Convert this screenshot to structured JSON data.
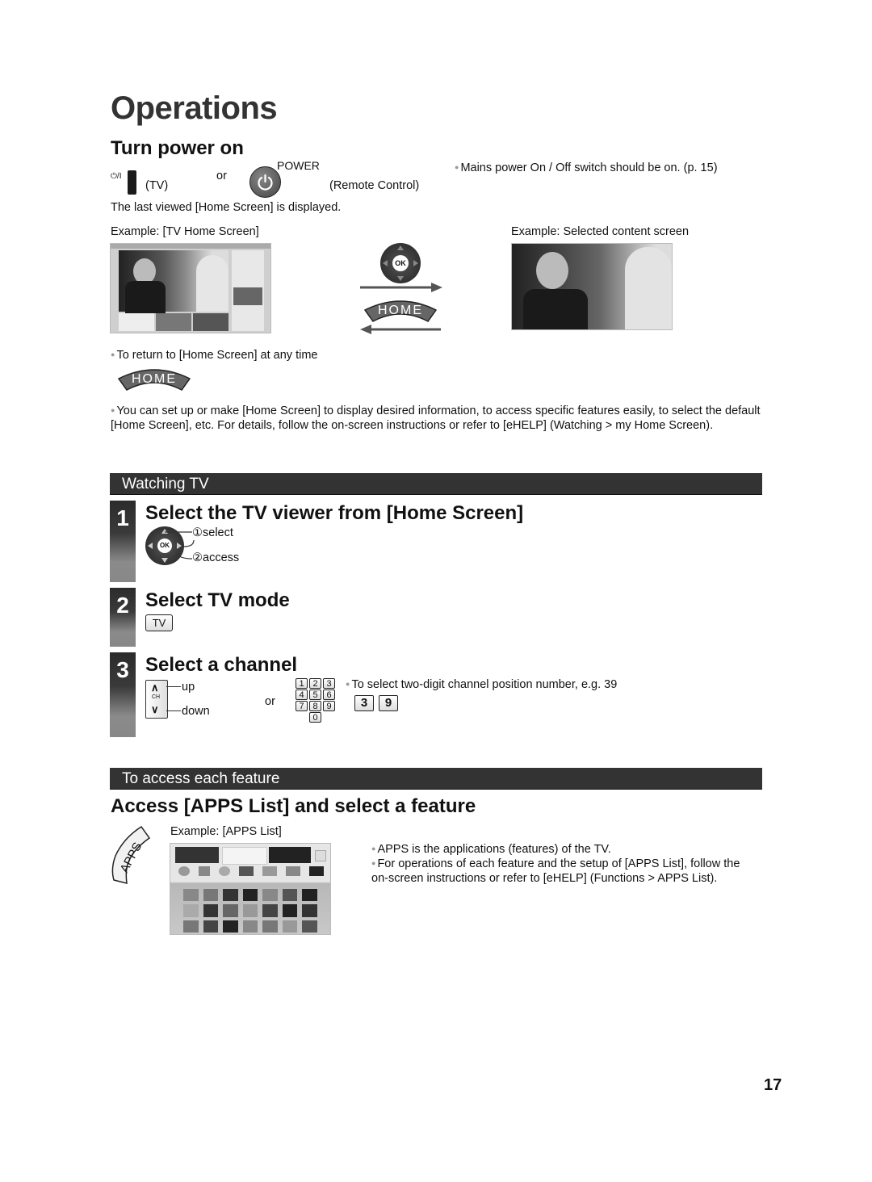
{
  "page": {
    "title": "Operations",
    "page_number": "17"
  },
  "power": {
    "heading": "Turn power on",
    "tv_switch_symbol": "⏻/I",
    "tv_label": "(TV)",
    "or_label": "or",
    "power_button_label": "POWER",
    "remote_label": "(Remote Control)",
    "mains_note": "Mains power On / Off switch should be on. (p. 15)",
    "last_viewed_text": "The last viewed [Home Screen] is displayed.",
    "example_home_label": "Example: [TV Home Screen]",
    "example_content_label": "Example: Selected content screen",
    "ok_label": "OK",
    "home_label": "HOME",
    "return_note": "To return to [Home Screen] at any time",
    "setup_note": "You can set up or make [Home Screen] to display desired information, to access specific features easily, to select the default [Home Screen], etc. For details, follow the on-screen instructions or refer to [eHELP] (Watching > my Home Screen)."
  },
  "watching": {
    "bar_label": "Watching TV",
    "steps": [
      {
        "number": "1",
        "heading": "Select the TV viewer from [Home Screen]",
        "select_label": "①select",
        "access_label": "②access",
        "ok_label": "OK"
      },
      {
        "number": "2",
        "heading": "Select TV mode",
        "key_label": "TV"
      },
      {
        "number": "3",
        "heading": "Select a channel",
        "ch_label": "CH",
        "up_label": "up",
        "down_label": "down",
        "or_label": "or",
        "keypad": [
          "1",
          "2",
          "3",
          "4",
          "5",
          "6",
          "7",
          "8",
          "9",
          "0"
        ],
        "two_digit_note": "To select two-digit channel position number, e.g. 39",
        "example_keys": [
          "3",
          "9"
        ]
      }
    ]
  },
  "features": {
    "bar_label": "To access each feature",
    "heading": "Access [APPS List] and select a feature",
    "apps_button_label": "APPS",
    "example_label": "Example: [APPS List]",
    "notes": [
      "APPS is the applications (features) of the TV.",
      "For operations of each feature and the setup of [APPS List], follow the on-screen instructions or refer to [eHELP] (Functions > APPS List)."
    ]
  }
}
